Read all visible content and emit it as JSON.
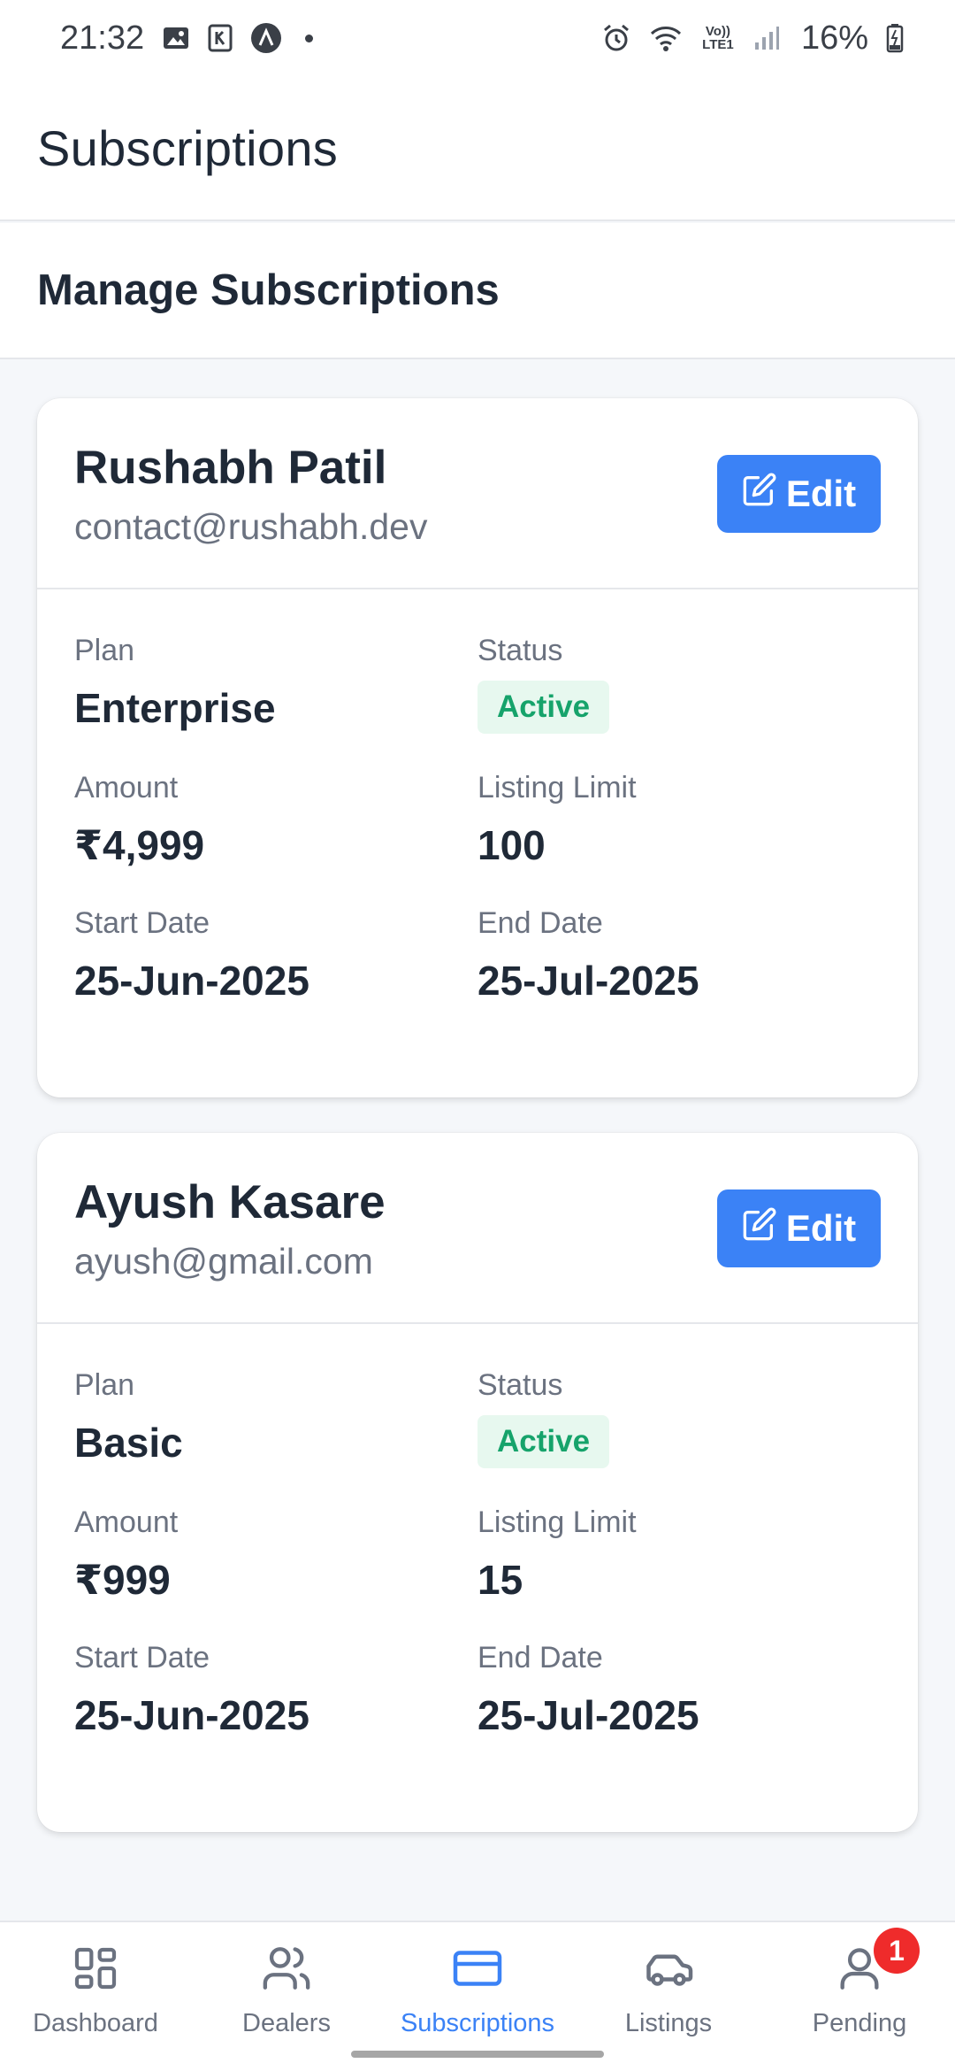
{
  "status_bar": {
    "time": "21:32",
    "battery_percent": "16%",
    "network_label": "Vo)) LTE1",
    "icons": [
      "image-icon",
      "k-app-icon",
      "a-app-icon",
      "dot-icon",
      "alarm-icon",
      "wifi-icon",
      "signal-icon",
      "battery-icon"
    ]
  },
  "header": {
    "title": "Subscriptions"
  },
  "section": {
    "title": "Manage Subscriptions"
  },
  "cards": [
    {
      "name": "Rushabh Patil",
      "email": "contact@rushabh.dev",
      "edit_label": "Edit",
      "plan_label": "Plan",
      "plan": "Enterprise",
      "status_label": "Status",
      "status": "Active",
      "amount_label": "Amount",
      "amount": "₹4,999",
      "limit_label": "Listing Limit",
      "limit": "100",
      "start_label": "Start Date",
      "start": "25-Jun-2025",
      "end_label": "End Date",
      "end": "25-Jul-2025"
    },
    {
      "name": "Ayush Kasare",
      "email": "ayush@gmail.com",
      "edit_label": "Edit",
      "plan_label": "Plan",
      "plan": "Basic",
      "status_label": "Status",
      "status": "Active",
      "amount_label": "Amount",
      "amount": "₹999",
      "limit_label": "Listing Limit",
      "limit": "15",
      "start_label": "Start Date",
      "start": "25-Jun-2025",
      "end_label": "End Date",
      "end": "25-Jul-2025"
    }
  ],
  "nav": {
    "items": [
      {
        "label": "Dashboard",
        "icon": "dashboard-icon"
      },
      {
        "label": "Dealers",
        "icon": "users-icon"
      },
      {
        "label": "Subscriptions",
        "icon": "card-icon",
        "active": true
      },
      {
        "label": "Listings",
        "icon": "car-icon"
      },
      {
        "label": "Pending",
        "icon": "user-icon",
        "badge": "1"
      }
    ]
  },
  "colors": {
    "accent": "#3b82f6",
    "active_text": "#16a36b",
    "active_bg": "#e7f8ef",
    "badge": "#ef2b2b"
  }
}
